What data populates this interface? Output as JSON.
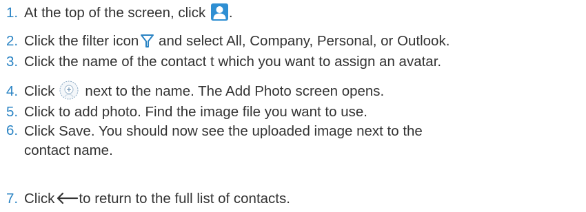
{
  "steps": [
    {
      "number": "1.",
      "before": "At the top of the screen, click",
      "icon": "person-icon",
      "after": "."
    },
    {
      "number": "2.",
      "before": "Click the filter icon",
      "icon": "filter-icon",
      "after": "and select All, Company, Personal, or Outlook."
    },
    {
      "number": "3.",
      "text": "Click the name of the contact t which you want to assign an avatar."
    },
    {
      "number": "4.",
      "before": "Click",
      "icon": "add-photo-icon",
      "after": "next to the name. The Add Photo screen opens."
    },
    {
      "number": "5.",
      "text": "Click to add photo. Find the image file you want to use."
    },
    {
      "number": "6.",
      "text": "Click Save. You should now see the uploaded image next to the contact name."
    },
    {
      "number": "7.",
      "before": "Click",
      "icon": "back-arrow-icon",
      "after": "to return to the full list of contacts."
    }
  ],
  "colors": {
    "number": "#2b84c4",
    "text": "#333333",
    "person_icon_bg": "#2f8fd3",
    "filter_icon": "#2b84c4"
  }
}
